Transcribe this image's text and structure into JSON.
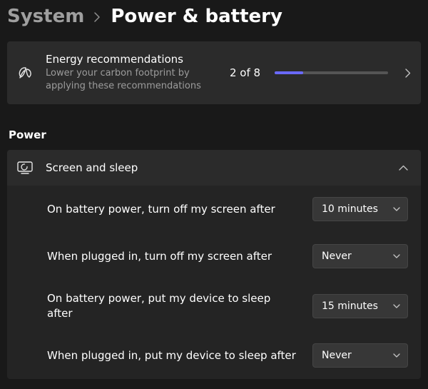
{
  "breadcrumb": {
    "parent": "System",
    "current": "Power & battery"
  },
  "recommendation": {
    "title": "Energy recommendations",
    "subtitle": "Lower your carbon footprint by applying these recommendations",
    "count_text": "2 of 8",
    "progress_completed": 2,
    "progress_total": 8
  },
  "section": {
    "power_heading": "Power"
  },
  "screen_sleep": {
    "header_label": "Screen and sleep",
    "expanded": true,
    "rows": [
      {
        "label": "On battery power, turn off my screen after",
        "value": "10 minutes"
      },
      {
        "label": "When plugged in, turn off my screen after",
        "value": "Never"
      },
      {
        "label": "On battery power, put my device to sleep after",
        "value": "15 minutes"
      },
      {
        "label": "When plugged in, put my device to sleep after",
        "value": "Never"
      }
    ]
  },
  "colors": {
    "accent": "#6a69ff",
    "card_bg": "#2b2b2b",
    "body_bg": "#242424"
  }
}
